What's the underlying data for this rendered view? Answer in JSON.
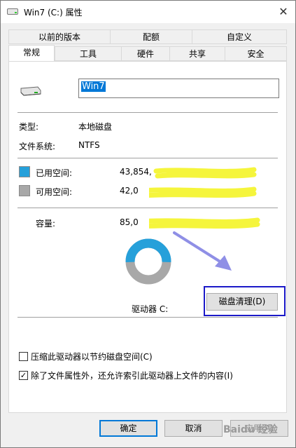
{
  "window": {
    "title": "Win7 (C:) 属性",
    "close_glyph": "✕"
  },
  "tabs": {
    "row1": [
      "以前的版本",
      "配额",
      "自定义"
    ],
    "row2": [
      "常规",
      "工具",
      "硬件",
      "共享",
      "安全"
    ],
    "active": "常规"
  },
  "general": {
    "drive_name": "Win7",
    "type_label": "类型:",
    "type_value": "本地磁盘",
    "fs_label": "文件系统:",
    "fs_value": "NTFS",
    "used_label": "已用空间:",
    "used_value": "43,854,",
    "free_label": "可用空间:",
    "free_value": "42,0",
    "capacity_label": "容量:",
    "capacity_value": "85,0",
    "drive_label": "驱动器 C:",
    "cleanup_button": "磁盘清理(D)",
    "used_fraction": 0.51,
    "used_color": "#26a0da",
    "free_color": "#a8a8a8"
  },
  "options": {
    "compress_label": "压缩此驱动器以节约磁盘空间(C)",
    "compress_checked": false,
    "index_label": "除了文件属性外，还允许索引此驱动器上文件的内容(I)",
    "index_checked": true,
    "check_glyph": "✓"
  },
  "buttons": {
    "ok": "确定",
    "cancel": "取消",
    "apply": "应用(A)"
  },
  "annotations": {
    "highlight_color": "#1b19c8",
    "arrow_color": "#8f8fe6",
    "redaction_color": "#f5f53c"
  },
  "watermark": {
    "text": "Baidu 经验"
  }
}
